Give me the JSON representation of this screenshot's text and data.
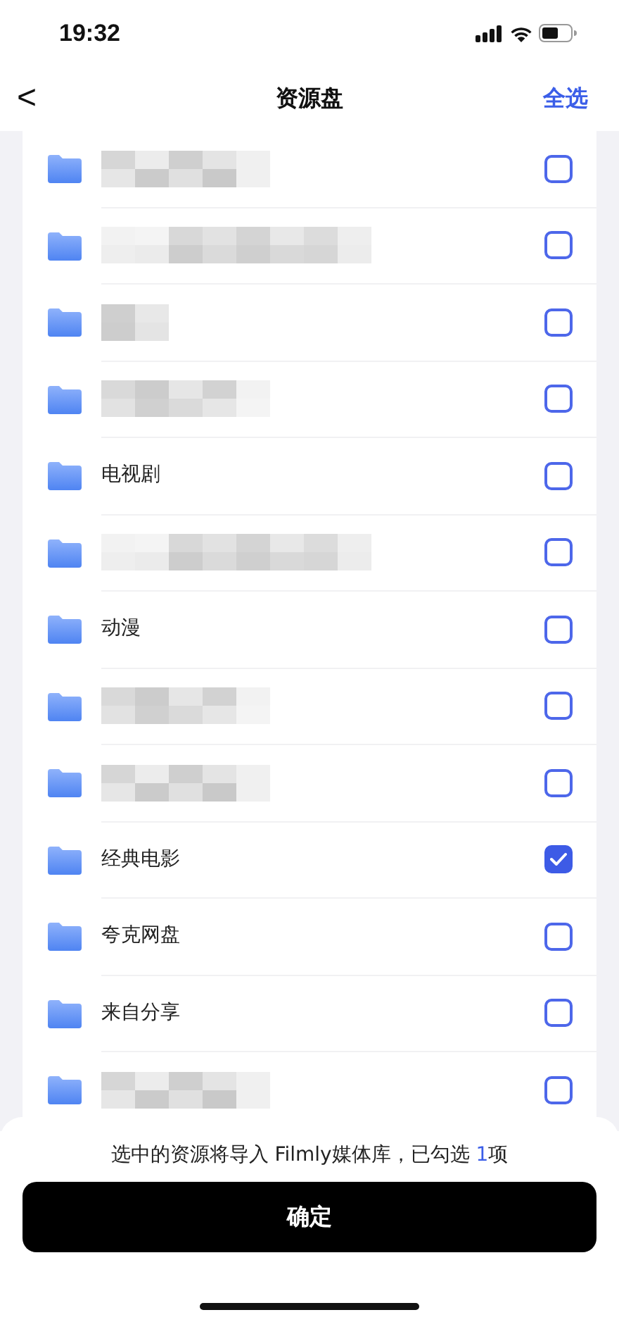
{
  "status_bar": {
    "time": "19:32"
  },
  "nav": {
    "back": "<",
    "title": "资源盘",
    "action": "全选"
  },
  "folders": [
    {
      "kind": "blurred",
      "checked": false
    },
    {
      "kind": "blurred",
      "checked": false
    },
    {
      "kind": "blurred",
      "checked": false
    },
    {
      "kind": "blurred",
      "checked": false
    },
    {
      "kind": "named",
      "name": "电视剧",
      "checked": false
    },
    {
      "kind": "blurred",
      "checked": false
    },
    {
      "kind": "named",
      "name": "动漫",
      "checked": false
    },
    {
      "kind": "blurred",
      "checked": false
    },
    {
      "kind": "blurred",
      "checked": false
    },
    {
      "kind": "named",
      "name": "经典电影",
      "checked": true
    },
    {
      "kind": "named",
      "name": "夸克网盘",
      "checked": false
    },
    {
      "kind": "named",
      "name": "来自分享",
      "checked": false
    },
    {
      "kind": "blurred",
      "checked": false
    }
  ],
  "footer": {
    "summary_prefix": "选中的资源将导入 Filmly媒体库，已勾选 ",
    "selected_count": "1",
    "summary_suffix": "项",
    "confirm": "确定"
  }
}
